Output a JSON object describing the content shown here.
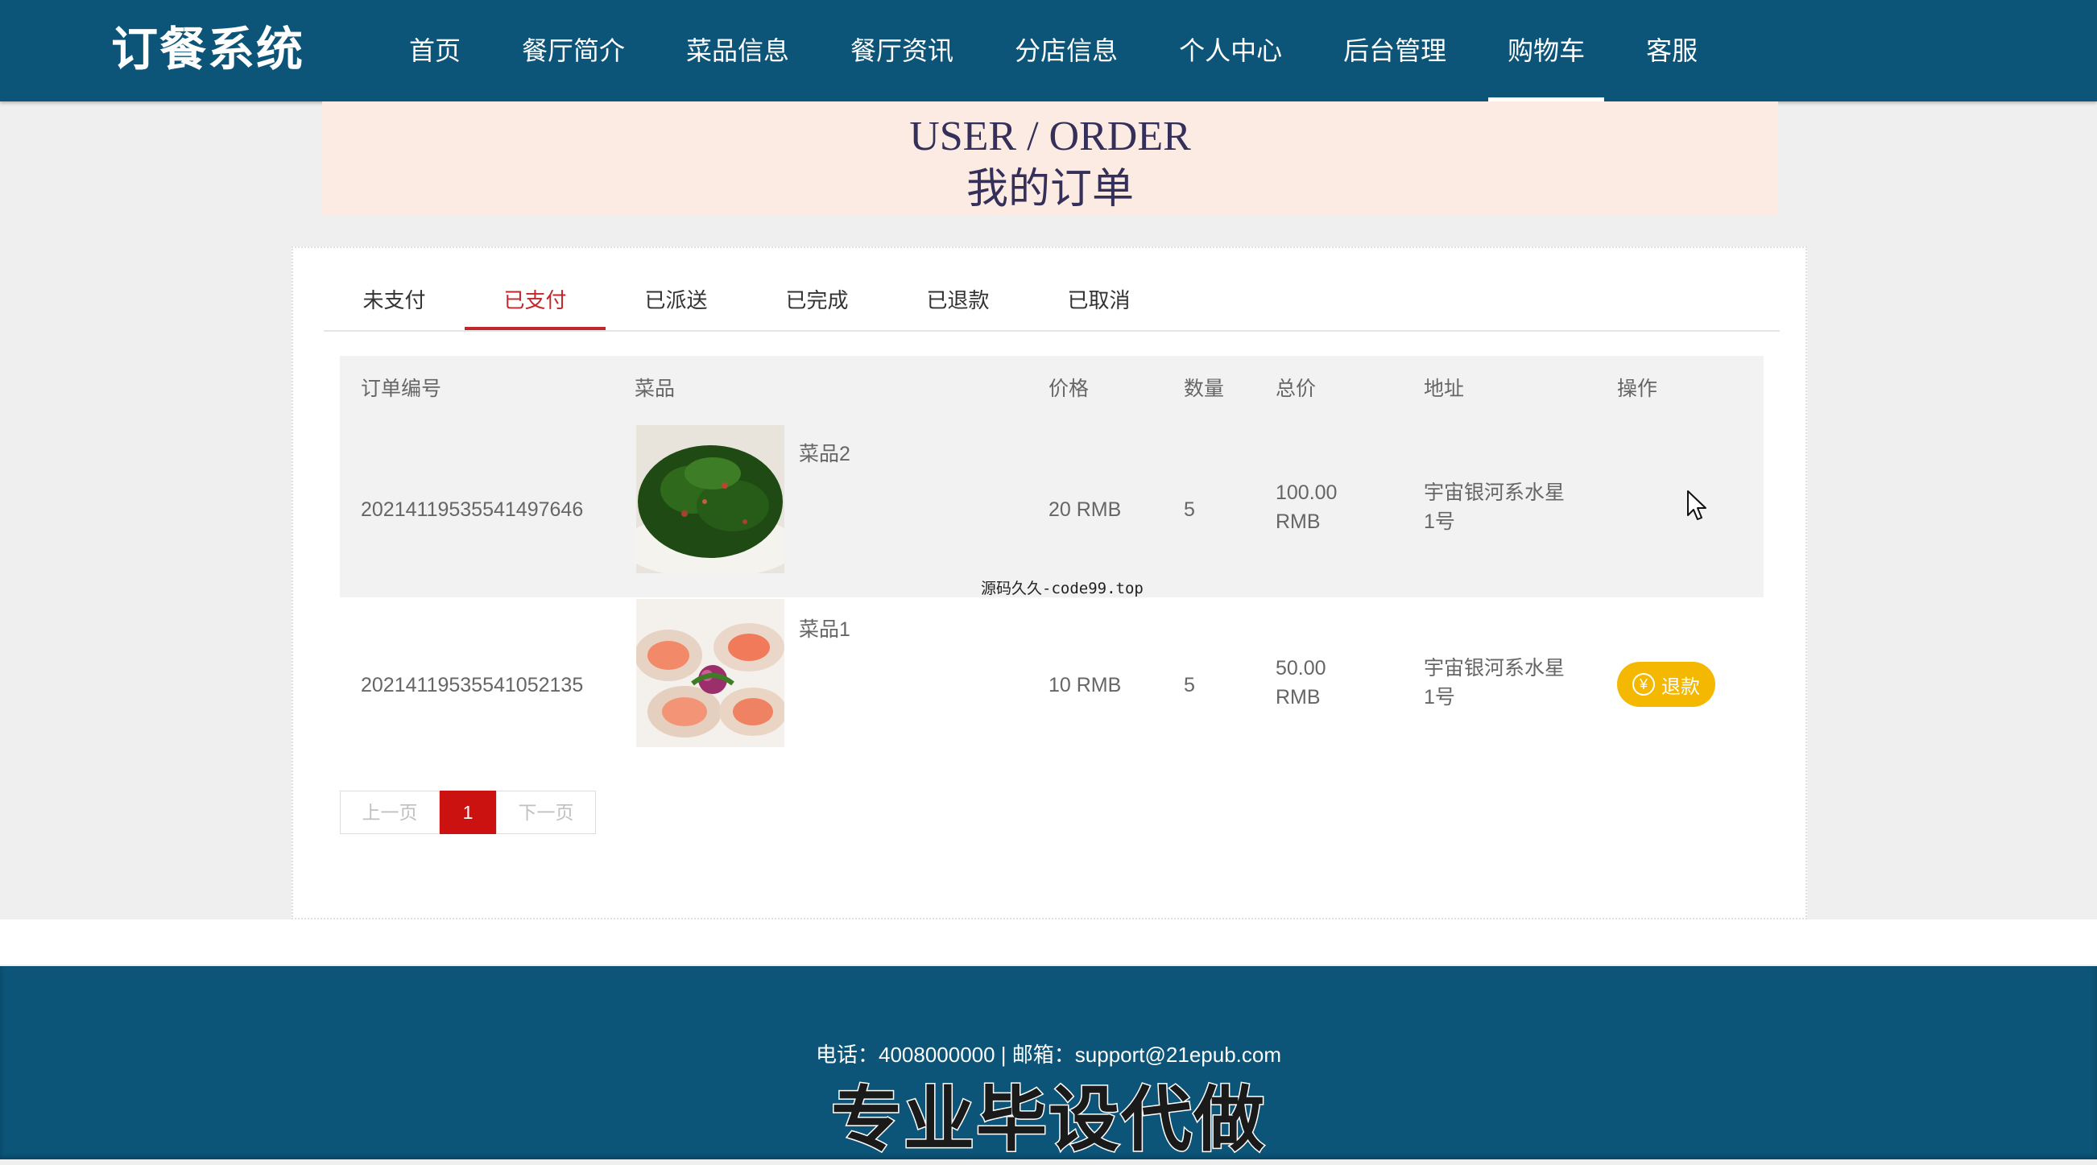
{
  "header": {
    "logo": "订餐系统",
    "nav": [
      {
        "label": "首页",
        "active": false
      },
      {
        "label": "餐厅简介",
        "active": false
      },
      {
        "label": "菜品信息",
        "active": false
      },
      {
        "label": "餐厅资讯",
        "active": false
      },
      {
        "label": "分店信息",
        "active": false
      },
      {
        "label": "个人中心",
        "active": false
      },
      {
        "label": "后台管理",
        "active": false
      },
      {
        "label": "购物车",
        "active": true
      },
      {
        "label": "客服",
        "active": false
      }
    ]
  },
  "banner": {
    "title_en": "USER / ORDER",
    "title_cn": "我的订单"
  },
  "tabs": [
    {
      "label": "未支付",
      "active": false
    },
    {
      "label": "已支付",
      "active": true
    },
    {
      "label": "已派送",
      "active": false
    },
    {
      "label": "已完成",
      "active": false
    },
    {
      "label": "已退款",
      "active": false
    },
    {
      "label": "已取消",
      "active": false
    }
  ],
  "table": {
    "headers": {
      "order_no": "订单编号",
      "dish": "菜品",
      "price": "价格",
      "qty": "数量",
      "total": "总价",
      "address": "地址",
      "action": "操作"
    },
    "rows": [
      {
        "order_no": "20214119535541497646",
        "dish_name": "菜品2",
        "dish_image": "stir-fried-greens-photo",
        "price": "20 RMB",
        "qty": "5",
        "total_amount": "100.00",
        "total_unit": "RMB",
        "address_line1": "宇宙银河系水星",
        "address_line2": "1号",
        "action_label": ""
      },
      {
        "order_no": "20214119535541052135",
        "dish_name": "菜品1",
        "dish_image": "scallop-dish-photo",
        "price": "10 RMB",
        "qty": "5",
        "total_amount": "50.00",
        "total_unit": "RMB",
        "address_line1": "宇宙银河系水星",
        "address_line2": "1号",
        "action_label": "退款"
      }
    ]
  },
  "pager": {
    "prev": "上一页",
    "current": "1",
    "next": "下一页"
  },
  "watermark": "源码久久-code99.top",
  "footer": {
    "contact": "电话：4008000000 | 邮箱：support@21epub.com",
    "caption": "专业毕设代做"
  },
  "colors": {
    "nav_bg": "#0c5478",
    "accent_red": "#c1272d",
    "refund_button": "#f5b800",
    "banner_bg": "#fcebe3"
  },
  "icons": {
    "refund": "yen-circle-icon",
    "cursor": "mouse-pointer-icon"
  }
}
